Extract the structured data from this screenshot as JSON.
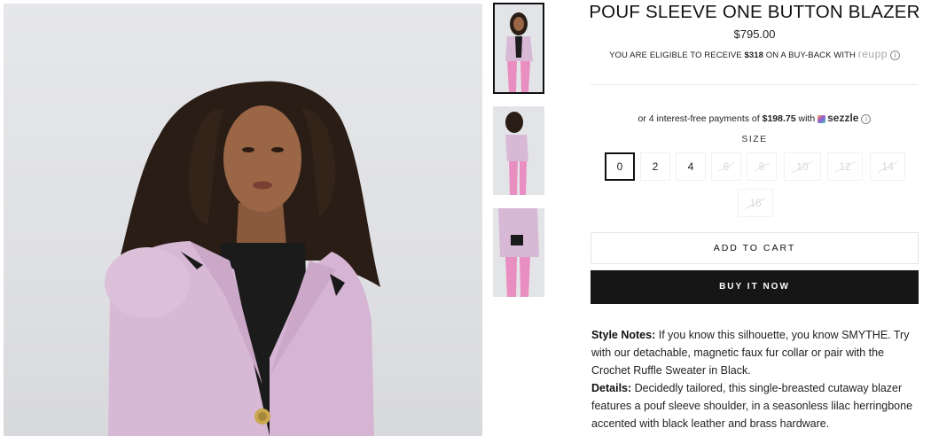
{
  "product": {
    "title": "POUF SLEEVE ONE BUTTON BLAZER",
    "price": "$795.00",
    "buyback": {
      "prefix": "YOU ARE ELIGIBLE TO RECEIVE ",
      "amount": "$318",
      "suffix": " ON A BUY-BACK WITH ",
      "brand": "reupp",
      "info_icon": "info-icon"
    },
    "installments": {
      "prefix": "or 4 interest-free payments of ",
      "amount": "$198.75",
      "middle": " with ",
      "provider": "sezzle",
      "info_icon": "info-icon"
    },
    "size_label": "SIZE",
    "sizes": [
      {
        "label": "0",
        "available": true,
        "selected": true
      },
      {
        "label": "2",
        "available": true,
        "selected": false
      },
      {
        "label": "4",
        "available": true,
        "selected": false
      },
      {
        "label": "6",
        "available": false,
        "selected": false
      },
      {
        "label": "8",
        "available": false,
        "selected": false
      },
      {
        "label": "10",
        "available": false,
        "selected": false
      },
      {
        "label": "12",
        "available": false,
        "selected": false
      },
      {
        "label": "14",
        "available": false,
        "selected": false
      },
      {
        "label": "16",
        "available": false,
        "selected": false
      }
    ],
    "add_to_cart": "ADD TO CART",
    "buy_now": "BUY IT NOW",
    "style_notes_label": "Style Notes:",
    "style_notes": " If you know this silhouette, you know SMYTHE. Try with our detachable, magnetic faux fur collar or pair with the Crochet Ruffle Sweater in Black.",
    "details_label": "Details:",
    "details": " Decidedly tailored, this single-breasted cutaway blazer features a pouf sleeve shoulder, in a seasonless lilac herringbone accented with black leather and brass hardware."
  },
  "colors": {
    "lilac": "#d8b9d6",
    "black_button": "#161616",
    "selected_border": "#111111"
  }
}
